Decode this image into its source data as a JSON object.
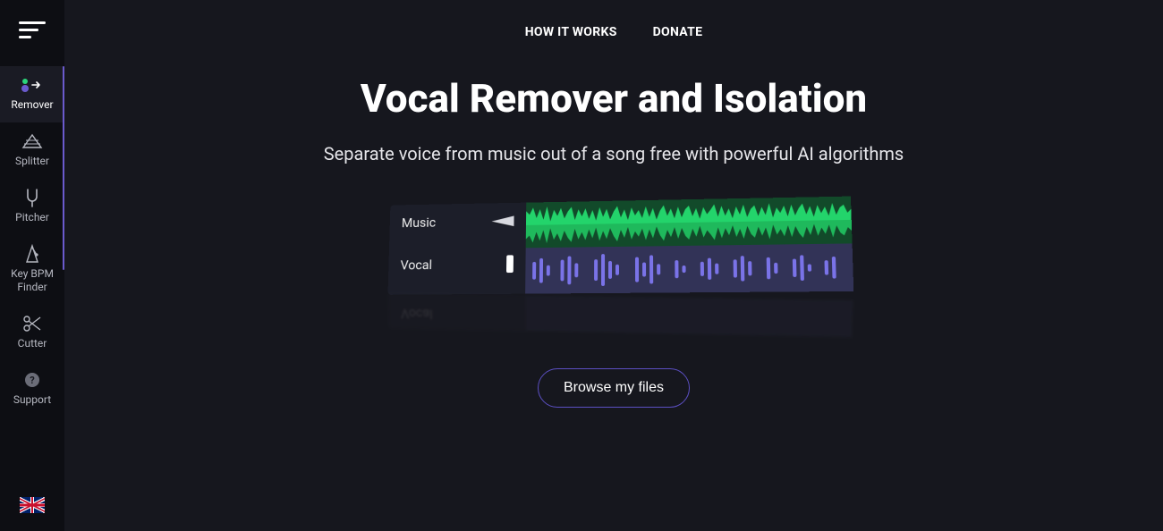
{
  "nav": {
    "how_it_works": "HOW IT WORKS",
    "donate": "DONATE"
  },
  "hero": {
    "title": "Vocal Remover and Isolation",
    "subtitle": "Separate voice from music out of a song free with powerful AI algorithms",
    "track_music": "Music",
    "track_vocal": "Vocal",
    "browse": "Browse my files"
  },
  "sidebar": {
    "items": [
      {
        "label": "Remover"
      },
      {
        "label": "Splitter"
      },
      {
        "label": "Pitcher"
      },
      {
        "label": "Key BPM\nFinder"
      },
      {
        "label": "Cutter"
      },
      {
        "label": "Support"
      }
    ]
  }
}
